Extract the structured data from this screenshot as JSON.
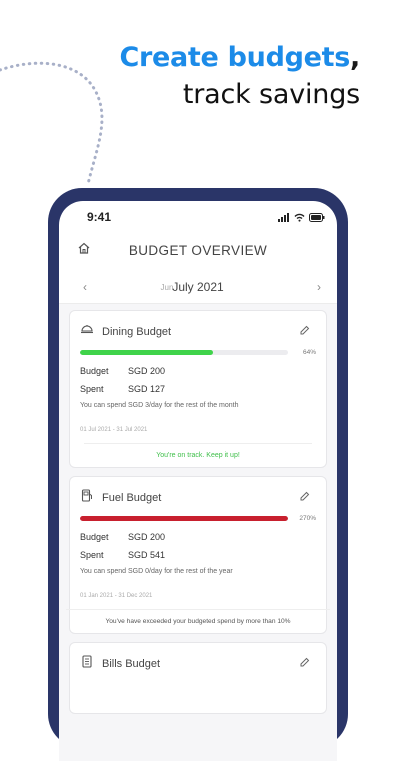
{
  "headline": {
    "accent": "Create budgets",
    "comma": ",",
    "line2": "track savings"
  },
  "colors": {
    "accent": "#1c8be8",
    "phone_frame": "#2a3568",
    "on_track": "#3fd34a",
    "over_budget": "#c8202e",
    "ok_text": "#3fbf4a"
  },
  "status_bar": {
    "time": "9:41"
  },
  "header": {
    "title": "BUDGET OVERVIEW",
    "home_icon": "home-icon"
  },
  "month_nav": {
    "previous": "Jun",
    "current": "July 2021"
  },
  "budgets": [
    {
      "title": "Dining Budget",
      "icon": "dining-icon",
      "progress": 0.64,
      "progress_label": "64%",
      "budget_label": "Budget",
      "budget_value": "SGD 200",
      "spent_label": "Spent",
      "spent_value": "SGD 127",
      "hint": "You can spend SGD 3/day for the rest of the month",
      "dates": "01 Jul 2021 - 31 Jul 2021",
      "footer": "You're on track. Keep it up!"
    },
    {
      "title": "Fuel Budget",
      "icon": "fuel-icon",
      "progress": 1.0,
      "progress_label": "270%",
      "budget_label": "Budget",
      "budget_value": "SGD 200",
      "spent_label": "Spent",
      "spent_value": "SGD 541",
      "hint": "You can spend SGD 0/day for the rest of the year",
      "dates": "01 Jan 2021 - 31 Dec 2021",
      "footer": "You've have exceeded your budgeted spend by more than 10%"
    },
    {
      "title": "Bills Budget",
      "icon": "bills-icon"
    }
  ]
}
